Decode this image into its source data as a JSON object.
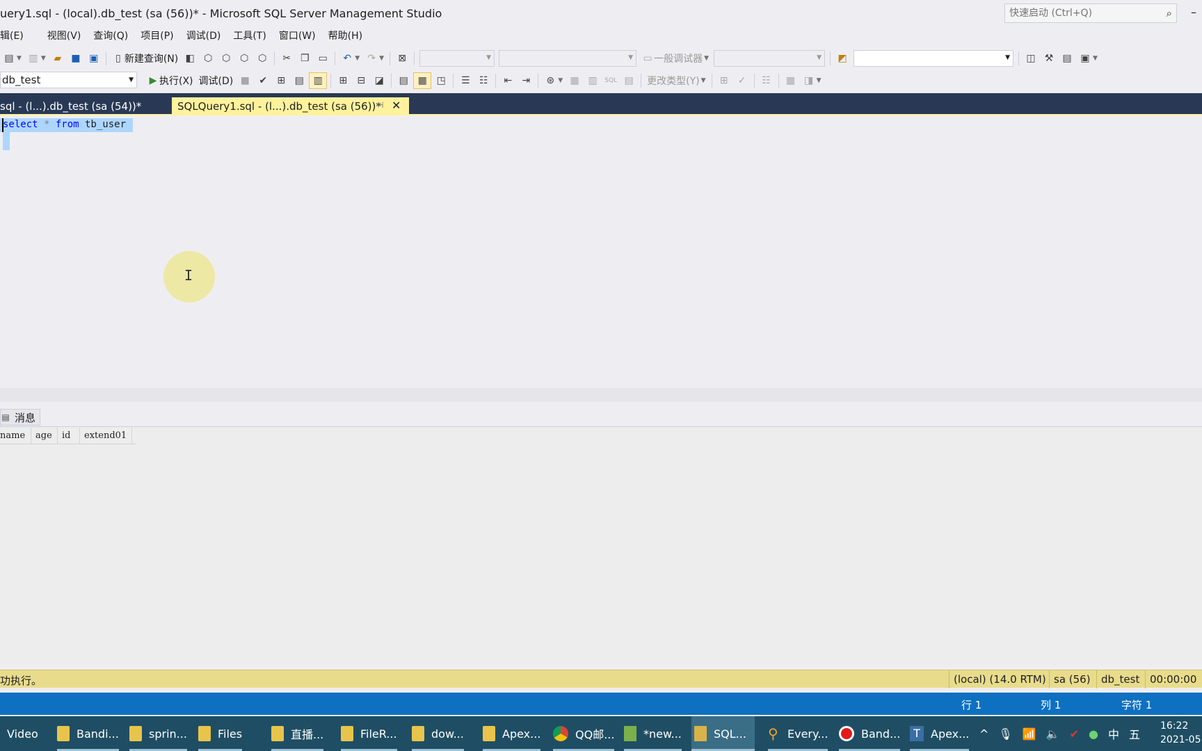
{
  "window": {
    "title": "uery1.sql - (local).db_test (sa (56))* - Microsoft SQL Server Management Studio",
    "quick_launch_placeholder": "快速启动 (Ctrl+Q)",
    "minimize_glyph": "–"
  },
  "menu": [
    "辑(E)",
    "视图(V)",
    "查询(Q)",
    "项目(P)",
    "调试(D)",
    "工具(T)",
    "窗口(W)",
    "帮助(H)"
  ],
  "toolbar1": {
    "new_query_label": "新建查询(N)",
    "debugger_label": "一般调试器"
  },
  "toolbar2": {
    "database": "db_test",
    "execute_label": "执行(X)",
    "debug_label": "调试(D)",
    "change_type_label": "更改类型(Y)"
  },
  "tabs": {
    "inactive": "sql - (l...).db_test (sa (54))*",
    "active": "SQLQuery1.sql - (l...).db_test (sa (56))*"
  },
  "editor": {
    "kw_select": "select",
    "op_star": " * ",
    "kw_from": "from",
    "table": " tb_user"
  },
  "results": {
    "messages_tab": "消息",
    "columns": [
      "name",
      "age",
      "id",
      "extend01"
    ]
  },
  "query_status": {
    "message": "功执行。",
    "server": "(local) (14.0 RTM)",
    "login": "sa (56)",
    "database": "db_test",
    "elapsed": "00:00:00"
  },
  "editor_status": {
    "row": "行 1",
    "col": "列 1",
    "char": "字符 1"
  },
  "taskbar": {
    "items": [
      "Video",
      "Bandi...",
      "sprin...",
      "Files",
      "直播...",
      "FileR...",
      "dow...",
      "Apex...",
      "QQ邮...",
      "*new...",
      "SQL...",
      "Every...",
      "Band...",
      "Apex..."
    ],
    "tray_ime_lang": "中",
    "tray_ime_mode": "五",
    "time": "16:22",
    "date": "2021-05"
  },
  "colors": {
    "tab_strip": "#293955",
    "active_tab": "#fff29d",
    "selection": "#add6ff",
    "keyword": "#0000ff",
    "status_blue": "#0e70c0",
    "query_status": "#e8dc8c",
    "taskbar": "#1f4e64"
  }
}
